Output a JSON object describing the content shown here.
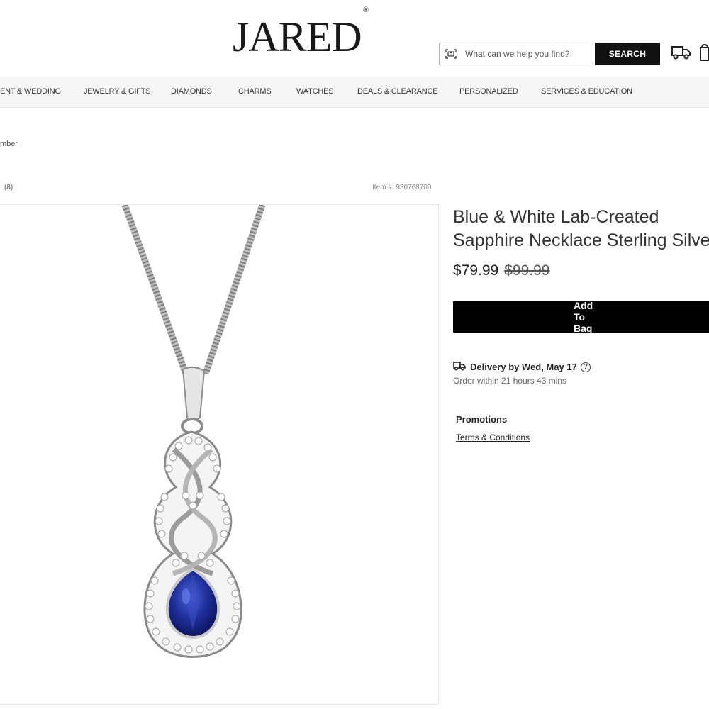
{
  "header": {
    "logo": "JARED",
    "logo_mark": "®",
    "search": {
      "placeholder": "What can we help you find?",
      "button_label": "SEARCH"
    },
    "icons": [
      "camera-search-icon",
      "truck-icon",
      "bag-icon"
    ]
  },
  "nav": {
    "items": [
      "ENT & WEDDING",
      "JEWELRY & GIFTS",
      "DIAMONDS",
      "CHARMS",
      "WATCHES",
      "DEALS & CLEARANCE",
      "PERSONALIZED",
      "SERVICES & EDUCATION"
    ]
  },
  "breadcrumb": "mber",
  "rating_count": "(8)",
  "item_number": "Item #: 930768700",
  "product": {
    "title_line1": "Blue & White Lab-Created",
    "title_line2": "Sapphire Necklace Sterling Silver",
    "price": "$79.99",
    "original_price": "$99.99",
    "add_to_bag_label": "Add To Bag",
    "delivery_label": "Delivery by Wed, May 17",
    "delivery_help": "?",
    "order_within": "Order within 21 hours 43 mins",
    "promotions_label": "Promotions",
    "terms_label": "Terms & Conditions"
  },
  "colors": {
    "accent": "#000000",
    "nav_bg": "#f6f6f6",
    "sapphire": "#1f2f9a"
  }
}
